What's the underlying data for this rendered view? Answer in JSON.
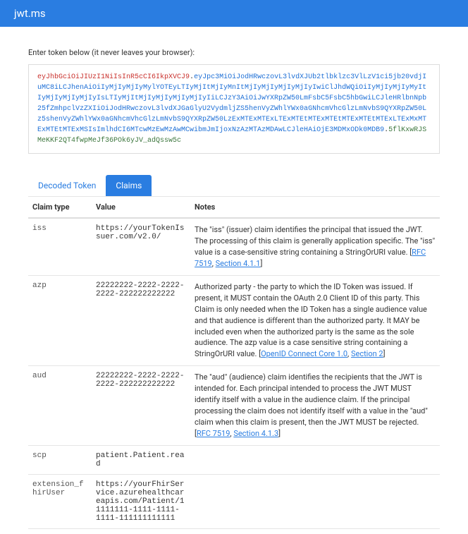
{
  "header": {
    "title": "jwt.ms"
  },
  "instruction": "Enter token below (it never leaves your browser):",
  "token": {
    "header": "eyJhbGciOiJIUzI1NiIsInR5cCI6IkpXVCJ9",
    "payload": "eyJpc3MiOiJodHRwczovL3lvdXJUb2tlbklzc3VlLzV1ci5jb20vdjIuMC8iLCJhenAiOiIyMjIyMjIyMylYOTEyLTIyMjItMjIyMnItMjIyMjIyMjIyMjIyIwiClJhdWQiOiIyMjIyMjIyMyItIyMjIyMjIyMjIyIsLTIyMjItMjIyMjIyMjIyMjIyIiLCJzY3AiOiJwYXRpZW50LmFsbC5FsbC5hbGwiLCJleHRlbnNpb25fZmhpclVzZXIiOiJodHRwczovL3lvdXJGaGlyU2VydmljZS5henVyZWhlYWx0aGNhcmVhcGlzLmNvbS9QYXRpZW50Lz5shenVyZWhlYWx0aGNhcmVhcGlzLmNvbS9QYXRpZW50LzExMTExMTExLTExMTEtMTExMTEtMTExMTEtMTExLTExMxMTExMTEtMTExMSIsImlhdCI6MTcwMzEwMzAwMCwibmJmIjoxNzAzMTAzMDAwLCJleHAiOjE3MDMxODk0MDB9",
    "signature": "5flKxwRJSMeKKF2QT4fwpMeJf36POk6yJV_adQssw5c"
  },
  "tabs": {
    "decoded": "Decoded Token",
    "claims": "Claims"
  },
  "table": {
    "headers": {
      "type": "Claim type",
      "value": "Value",
      "notes": "Notes"
    },
    "rows": [
      {
        "type": "iss",
        "value": "https://yourTokenIssuer.com/v2.0/",
        "notes_pre": "The \"iss\" (issuer) claim identifies the principal that issued the JWT. The processing of this claim is generally application specific. The \"iss\" value is a case-sensitive string containing a StringOrURI value. [",
        "link1": "RFC 7519",
        "notes_mid": ", ",
        "link2": "Section 4.1.1",
        "notes_post": "]"
      },
      {
        "type": "azp",
        "value": "22222222-2222-2222-2222-222222222222",
        "notes_pre": "Authorized party - the party to which the ID Token was issued. If present, it MUST contain the OAuth 2.0 Client ID of this party. This Claim is only needed when the ID Token has a single audience value and that audience is different than the authorized party. It MAY be included even when the authorized party is the same as the sole audience. The azp value is a case sensitive string containing a StringOrURI value. [",
        "link1": "OpenID Connect Core 1.0",
        "notes_mid": ", ",
        "link2": "Section 2",
        "notes_post": "]"
      },
      {
        "type": "aud",
        "value": "22222222-2222-2222-2222-222222222222",
        "notes_pre": "The \"aud\" (audience) claim identifies the recipients that the JWT is intended for. Each principal intended to process the JWT MUST identify itself with a value in the audience claim. If the principal processing the claim does not identify itself with a value in the \"aud\" claim when this claim is present, then the JWT MUST be rejected. [",
        "link1": "RFC 7519",
        "notes_mid": ", ",
        "link2": "Section 4.1.3",
        "notes_post": "]"
      },
      {
        "type": "scp",
        "value": "patient.Patient.read",
        "notes_pre": "",
        "link1": "",
        "notes_mid": "",
        "link2": "",
        "notes_post": ""
      },
      {
        "type": "extension_fhirUser",
        "value": "https://yourFhirService.azurehealthcareapis.com/Patient/11111111-1111-1111-1111-111111111111",
        "notes_pre": "",
        "link1": "",
        "notes_mid": "",
        "link2": "",
        "notes_post": ""
      }
    ]
  }
}
